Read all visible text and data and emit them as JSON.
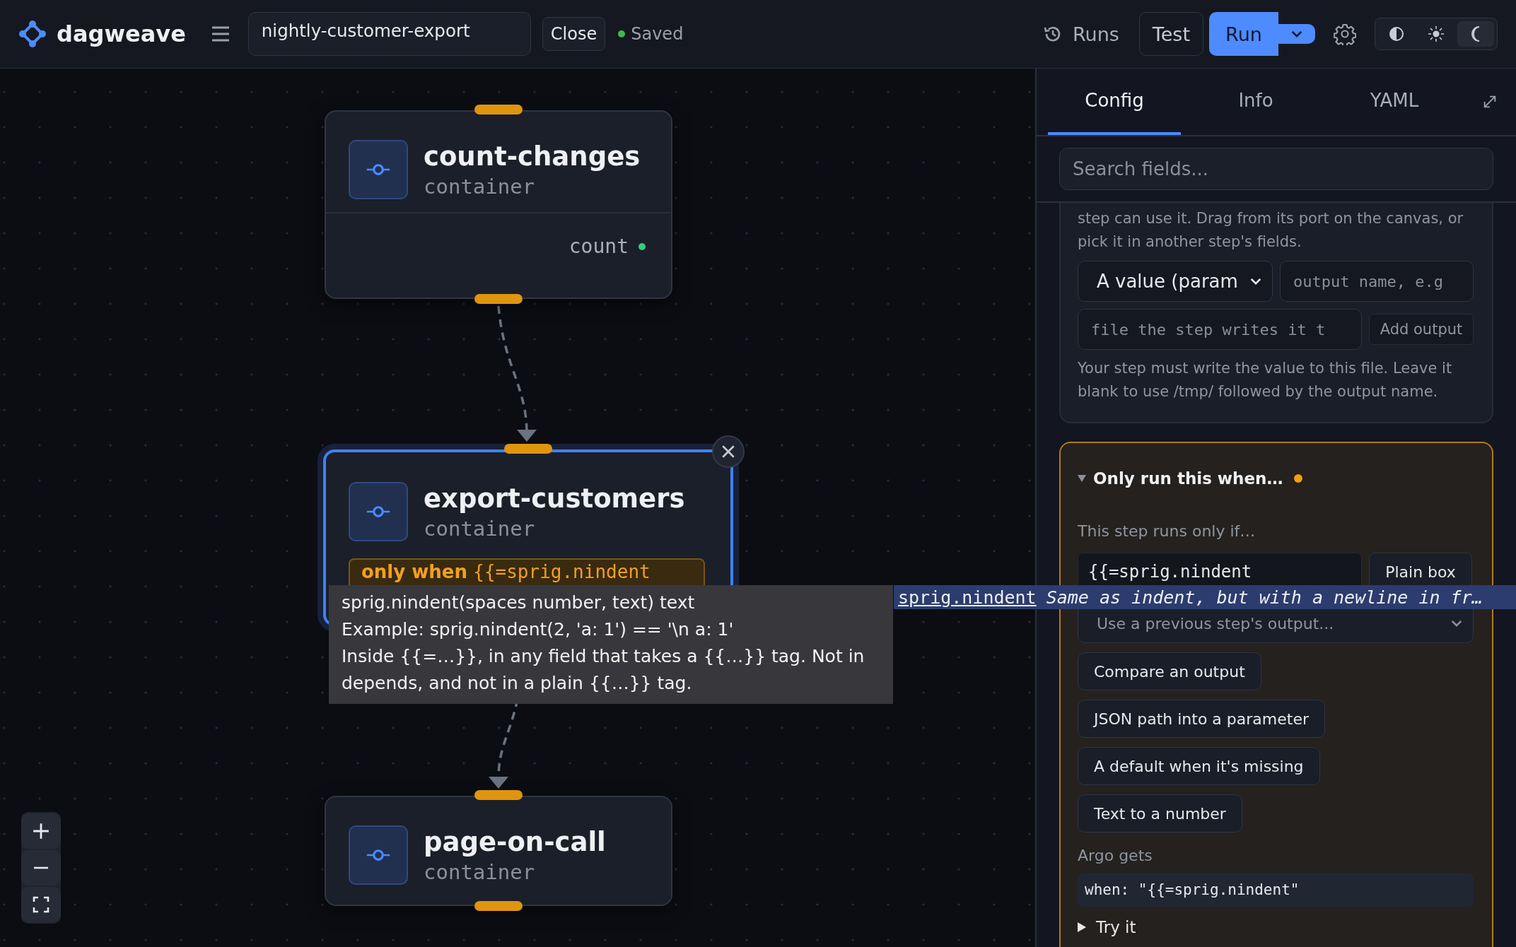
{
  "app": {
    "name": "dagweave"
  },
  "toolbar": {
    "workflow_name": "nightly-customer-export",
    "close_label": "Close",
    "save_status": "Saved",
    "runs_label": "Runs",
    "test_label": "Test",
    "run_label": "Run",
    "theme_modes": [
      {
        "kind": "contrast",
        "selected": false
      },
      {
        "kind": "light",
        "selected": false
      },
      {
        "kind": "dark",
        "selected": true
      }
    ]
  },
  "canvas": {
    "nodes": [
      {
        "name": "count-changes",
        "type": "container",
        "selected": false,
        "outputs": [
          "count"
        ]
      },
      {
        "name": "export-customers",
        "type": "container",
        "selected": true,
        "incoming_edge": true,
        "condition": {
          "label": "only when",
          "expression": "{{=sprig.nindent"
        }
      },
      {
        "name": "page-on-call",
        "type": "container",
        "selected": false,
        "incoming_edge": true
      }
    ]
  },
  "tooltip": {
    "signature": "sprig.nindent(spaces number, text) text",
    "example": "Example: sprig.nindent(2, 'a: 1') == '\\n a: 1'",
    "note": "Inside {{=…}}, in any field that takes a {{…}} tag. Not in depends, and not in a plain {{…}} tag."
  },
  "autocomplete": {
    "name": "sprig.nindent",
    "description": "Same as indent, but with a newline in fr…"
  },
  "panel": {
    "tabs": [
      {
        "label": "Config",
        "selected": true
      },
      {
        "label": "Info",
        "selected": false
      },
      {
        "label": "YAML",
        "selected": false
      }
    ],
    "search": {
      "placeholder": "Search fields..."
    },
    "outputs_section": {
      "help": "step can use it. Drag from its port on the canvas, or pick it in another step's fields.",
      "output_kind": "A value (param",
      "name_placeholder": "output name, e.g",
      "path_placeholder": "file the step writes it t",
      "add_label": "Add output",
      "path_help": "Your step must write the value to this file. Leave it blank to use /tmp/ followed by the output name."
    },
    "condition_section": {
      "title": "Only run this when…",
      "expanded": true,
      "modified": true,
      "intro": "This step runs only if…",
      "expression": "{{=sprig.nindent",
      "plain_box_label": "Plain box",
      "output_picker_placeholder": "Use a previous step's output...",
      "helpers": [
        "Compare an output",
        "JSON path into a parameter",
        "A default when it's missing",
        "Text to a number"
      ],
      "result_label": "Argo gets",
      "result": "when: \"{{=sprig.nindent\"",
      "try_it": {
        "label": "Try it",
        "expanded": false
      }
    }
  }
}
